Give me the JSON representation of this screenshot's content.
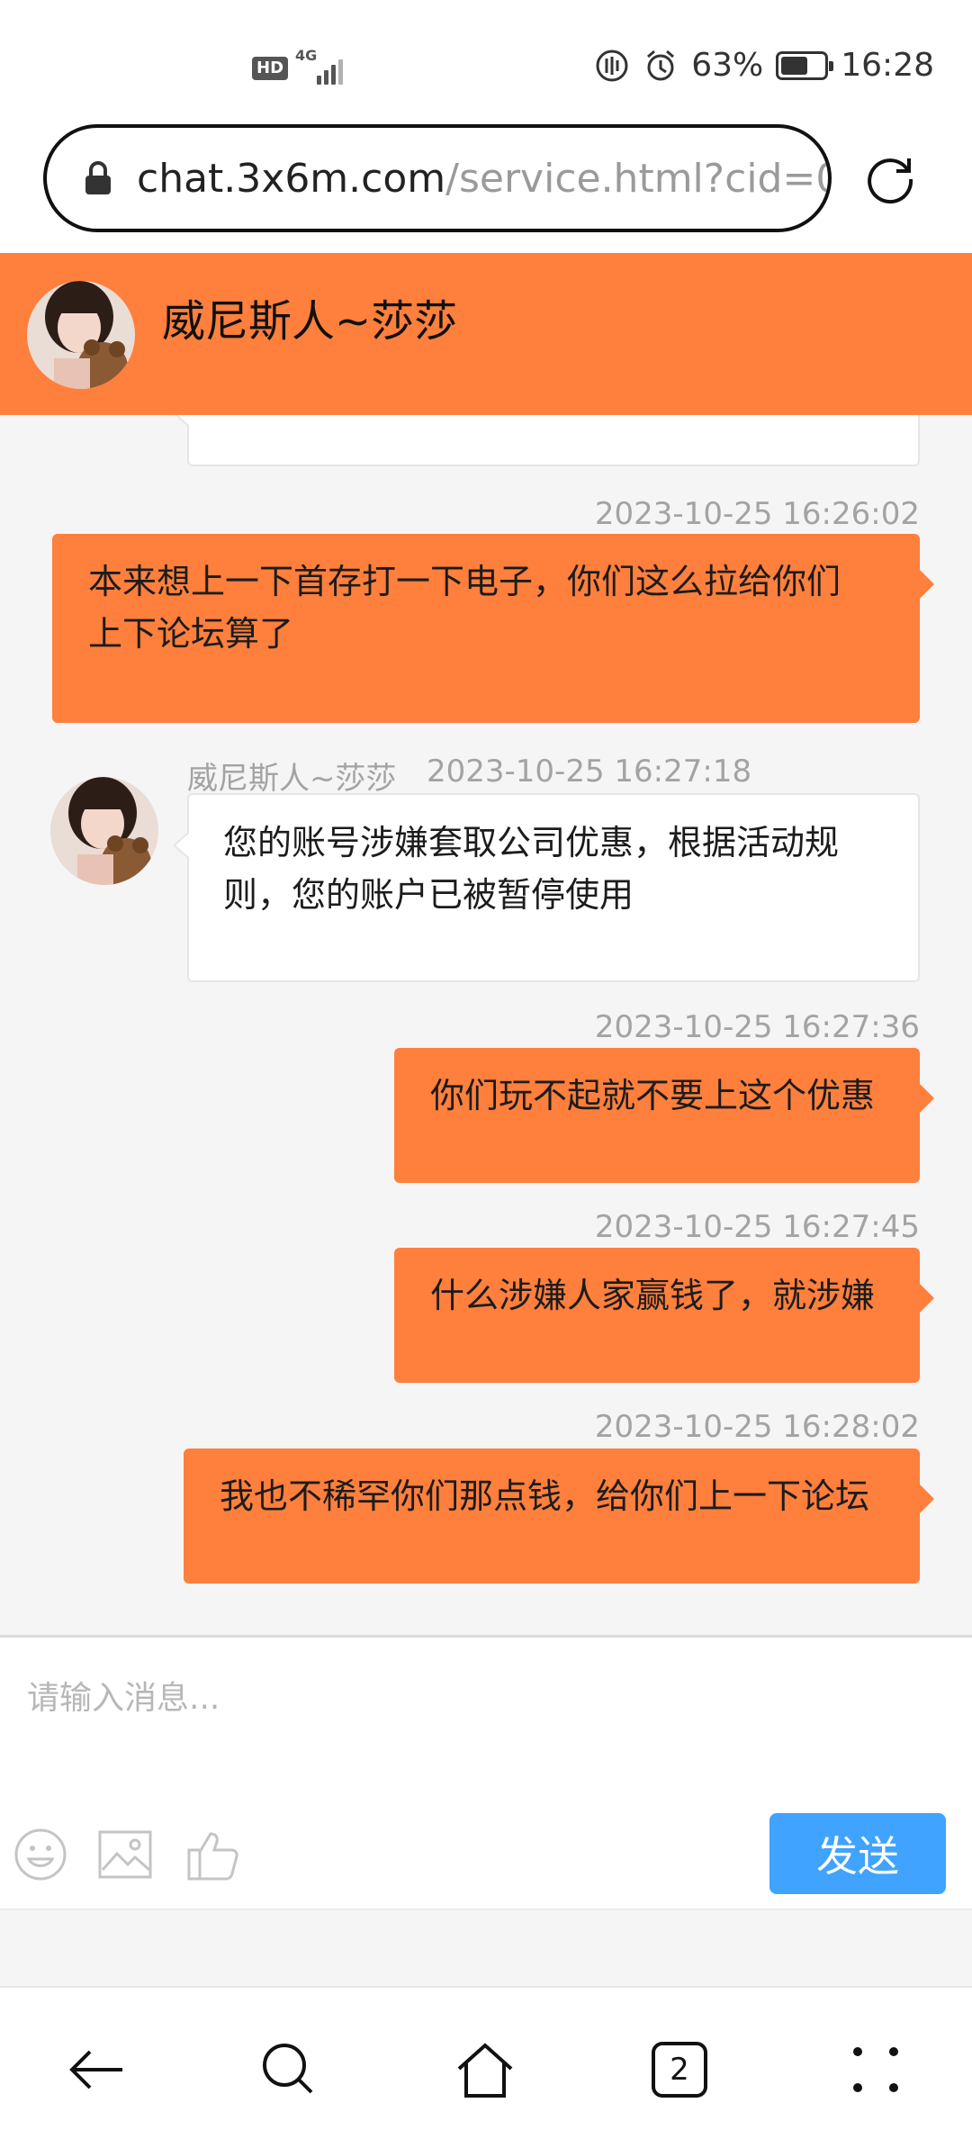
{
  "status_bar": {
    "hd": "HD",
    "network": "4G",
    "battery": "63%",
    "battery_level": 0.63,
    "time": "16:28"
  },
  "browser": {
    "url_host": "chat.3x6m.com",
    "url_path": "/service.html?cid=0",
    "tab_count": "2"
  },
  "chat": {
    "agent_name": "威尼斯人~莎莎",
    "messages": [
      {
        "dir": "in",
        "text": "",
        "partial": true
      },
      {
        "dir": "out",
        "time": "2023-10-25 16:26:02",
        "lines": [
          "本来想上一下首存打一下电子，你们这么拉给你们",
          "上下论坛算了"
        ]
      },
      {
        "dir": "in",
        "sender": "威尼斯人~莎莎",
        "time": "2023-10-25 16:27:18",
        "lines": [
          "您的账号涉嫌套取公司优惠，根据活动规",
          "则，您的账户已被暂停使用"
        ]
      },
      {
        "dir": "out",
        "time": "2023-10-25 16:27:36",
        "lines": [
          "你们玩不起就不要上这个优惠"
        ]
      },
      {
        "dir": "out",
        "time": "2023-10-25 16:27:45",
        "lines": [
          "什么涉嫌人家赢钱了，就涉嫌"
        ]
      },
      {
        "dir": "out",
        "time": "2023-10-25 16:28:02",
        "lines": [
          "我也不稀罕你们那点钱，给你们上一下论坛"
        ]
      }
    ]
  },
  "composer": {
    "placeholder": "请输入消息...",
    "send_label": "发送"
  },
  "icons": {
    "status": [
      "hd-icon",
      "signal-icon",
      "data-saver-icon",
      "alarm-icon",
      "battery-icon"
    ],
    "url": [
      "lock-icon",
      "reload-icon"
    ],
    "composer": [
      "emoji-icon",
      "image-icon",
      "thumbs-up-icon"
    ],
    "nav": [
      "back-icon",
      "search-icon",
      "home-icon",
      "tabs-icon",
      "menu-icon"
    ]
  },
  "colors": {
    "header": "#ff7f3d",
    "outgoing_bubble": "#ff7f3d",
    "send_button": "#3fa3ff",
    "background": "#f5f5f5"
  }
}
